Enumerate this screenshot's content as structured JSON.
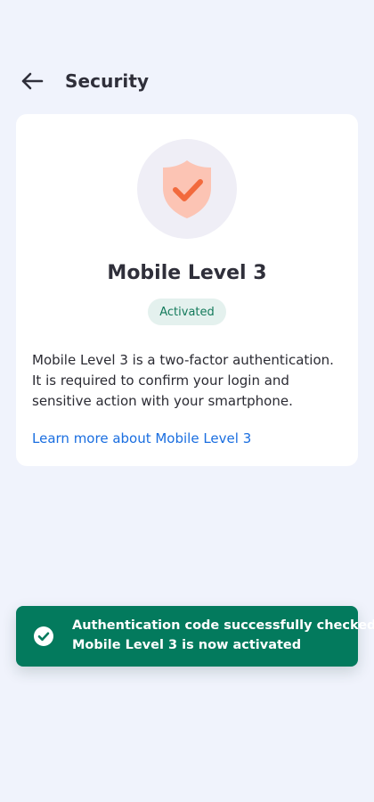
{
  "header": {
    "title": "Security",
    "back_icon": "arrow-left-icon"
  },
  "card": {
    "illustration_icon": "shield-check-icon",
    "title": "Mobile Level 3",
    "status_badge": "Activated",
    "description": "Mobile Level 3 is a two-factor authentication. It is required to confirm your login and sensitive action with your smartphone.",
    "learn_more_link": "Learn more about Mobile Level 3"
  },
  "toast": {
    "icon": "check-circle-icon",
    "line1": "Authentication code successfully checked.",
    "line2": "Mobile Level 3 is now activated"
  },
  "colors": {
    "background": "#f0f3fc",
    "card": "#ffffff",
    "badge_bg": "#e4f1ee",
    "badge_text": "#137a5b",
    "link": "#1a6ee0",
    "toast_bg": "#037a5d",
    "shield_fill": "#fcc4b4",
    "check_stroke": "#f26a3d"
  }
}
